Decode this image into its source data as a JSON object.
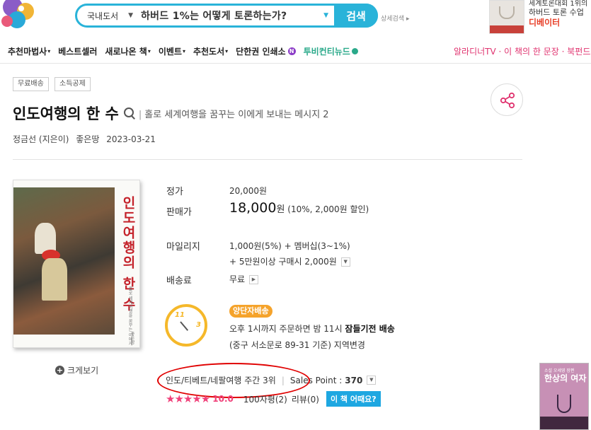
{
  "header": {
    "search_category": "국내도서",
    "search_query": "하버드 1%는 어떻게 토론하는가?",
    "search_button": "검색",
    "detail_search": "상세검색",
    "promo": {
      "line1": "세계토론대회 1위의",
      "line2": "하버드 토론 수업",
      "line3": "디베이터"
    }
  },
  "nav": {
    "items": [
      {
        "label": "추천마법사",
        "caret": "▾"
      },
      {
        "label": "베스트셀러",
        "caret": ""
      },
      {
        "label": "새로나온 책",
        "caret": "▾"
      },
      {
        "label": "이벤트",
        "caret": "▾"
      },
      {
        "label": "추천도서",
        "caret": "▾"
      },
      {
        "label": "단한권 인쇄소",
        "caret": ""
      }
    ],
    "new_badge": "N",
    "special": "투비컨티뉴드",
    "right": "알라디너TV · 이 책의 한 문장 · 북펀드"
  },
  "book": {
    "tags": [
      "무료배송",
      "소득공제"
    ],
    "title": "인도여행의 한 수",
    "subtitle": "홀로 세계여행을 꿈꾸는 이에게 보내는 메시지 2",
    "author": "정금선 (지은이)",
    "publisher": "좋은땅",
    "date": "2023-03-21",
    "cover_title": "인도여행의 한 수",
    "cover_sub": "홀로 세계여행을 꿈꾸는 이에게",
    "cover_pub": "좋은땅",
    "zoom_label": "크게보기"
  },
  "price": {
    "list_label": "정가",
    "list_value": "20,000원",
    "sale_label": "판매가",
    "sale_value": "18,000",
    "sale_unit": "원",
    "sale_discount": "(10%, 2,000원 할인)",
    "mileage_label": "마일리지",
    "mileage_line1": "1,000원(5%) + 멤버십(3~1%)",
    "mileage_line2": "+ 5만원이상 구매시 2,000원",
    "shipping_label": "배송료",
    "shipping_value": "무료"
  },
  "delivery": {
    "badge": "양단자배송",
    "clock_11": "11",
    "clock_3": "3",
    "line1_pre": "오후 1시까지 주문하면 밤 11시 ",
    "line1_bold": "잠들기전 배송",
    "line2": "(중구 서소문로 89-31 기준) 지역변경"
  },
  "rank": {
    "text": "인도/티베트/네팔여행 주간 3위",
    "sales_label": "Sales Point :",
    "sales_value": "370"
  },
  "rating": {
    "stars": "★★★★★",
    "score": "10.0",
    "reviews_100": "100자평(2)",
    "reviews": "리뷰(0)",
    "how_button": "이 책 어때요?"
  },
  "side_ad": {
    "title": "한상의 여자",
    "subtitle": "소설 오세영 장편"
  }
}
